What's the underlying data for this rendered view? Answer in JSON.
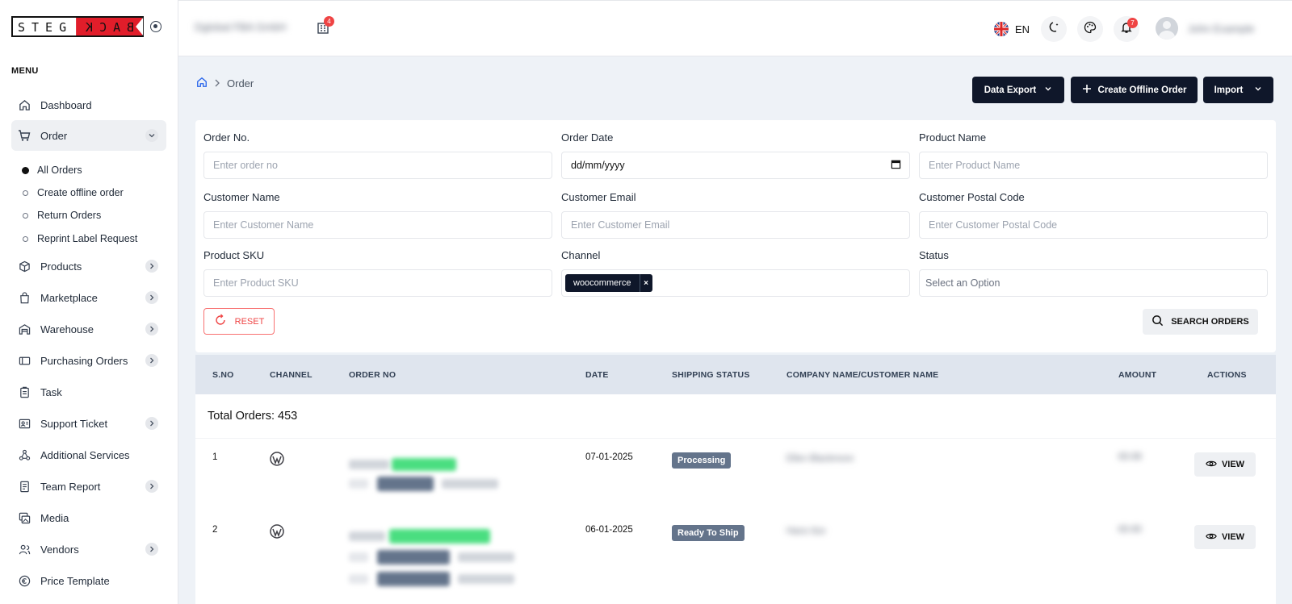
{
  "logo": {
    "left": "STEG",
    "right": "BACK"
  },
  "sidebar": {
    "menu_label": "MENU",
    "items": [
      {
        "label": "Dashboard",
        "icon": "home-icon"
      },
      {
        "label": "Order",
        "icon": "cart-icon"
      },
      {
        "label": "Products",
        "icon": "box-icon"
      },
      {
        "label": "Marketplace",
        "icon": "bag-icon"
      },
      {
        "label": "Warehouse",
        "icon": "warehouse-icon"
      },
      {
        "label": "Purchasing Orders",
        "icon": "card-icon"
      },
      {
        "label": "Task",
        "icon": "clipboard-icon"
      },
      {
        "label": "Support Ticket",
        "icon": "ticket-icon"
      },
      {
        "label": "Additional Services",
        "icon": "services-icon"
      },
      {
        "label": "Team Report",
        "icon": "report-icon"
      },
      {
        "label": "Media",
        "icon": "media-icon"
      },
      {
        "label": "Vendors",
        "icon": "vendors-icon"
      },
      {
        "label": "Price Template",
        "icon": "price-icon"
      }
    ],
    "order_sub": [
      "All Orders",
      "Create offline order",
      "Return Orders",
      "Reprint Label Request"
    ]
  },
  "topbar": {
    "company_name": "Dglobal FBA GmbH",
    "building_badge": "4",
    "lang": "EN",
    "notif_badge": "7",
    "user_name": "John Example"
  },
  "breadcrumb": {
    "current": "Order"
  },
  "actions": {
    "data_export": "Data Export",
    "create_offline": "Create Offline Order",
    "import": "Import"
  },
  "filters": {
    "order_no": {
      "label": "Order No.",
      "placeholder": "Enter order no"
    },
    "order_date": {
      "label": "Order Date",
      "value": "dd/mm/yyyy"
    },
    "product_name": {
      "label": "Product Name",
      "placeholder": "Enter Product Name"
    },
    "customer_name": {
      "label": "Customer Name",
      "placeholder": "Enter Customer Name"
    },
    "customer_email": {
      "label": "Customer Email",
      "placeholder": "Enter Customer Email"
    },
    "customer_postal": {
      "label": "Customer Postal Code",
      "placeholder": "Enter Customer Postal Code"
    },
    "product_sku": {
      "label": "Product SKU",
      "placeholder": "Enter Product SKU"
    },
    "channel": {
      "label": "Channel",
      "chip": "woocommerce",
      "chip_remove": "×"
    },
    "status": {
      "label": "Status",
      "placeholder": "Select an Option"
    },
    "reset": "RESET",
    "search": "SEARCH ORDERS"
  },
  "table": {
    "headers": [
      "S.NO",
      "CHANNEL",
      "ORDER NO",
      "DATE",
      "SHIPPING STATUS",
      "COMPANY NAME/CUSTOMER NAME",
      "AMOUNT",
      "ACTIONS"
    ],
    "total": "Total Orders: 453",
    "rows": [
      {
        "sno": "1",
        "date": "07-01-2025",
        "status": "Processing",
        "customer": "Ellen Blackmore",
        "amount": "€9.99",
        "action": "VIEW"
      },
      {
        "sno": "2",
        "date": "06-01-2025",
        "status": "Ready To Ship",
        "customer": "Hans Itze",
        "amount": "€9.90",
        "action": "VIEW"
      }
    ]
  }
}
